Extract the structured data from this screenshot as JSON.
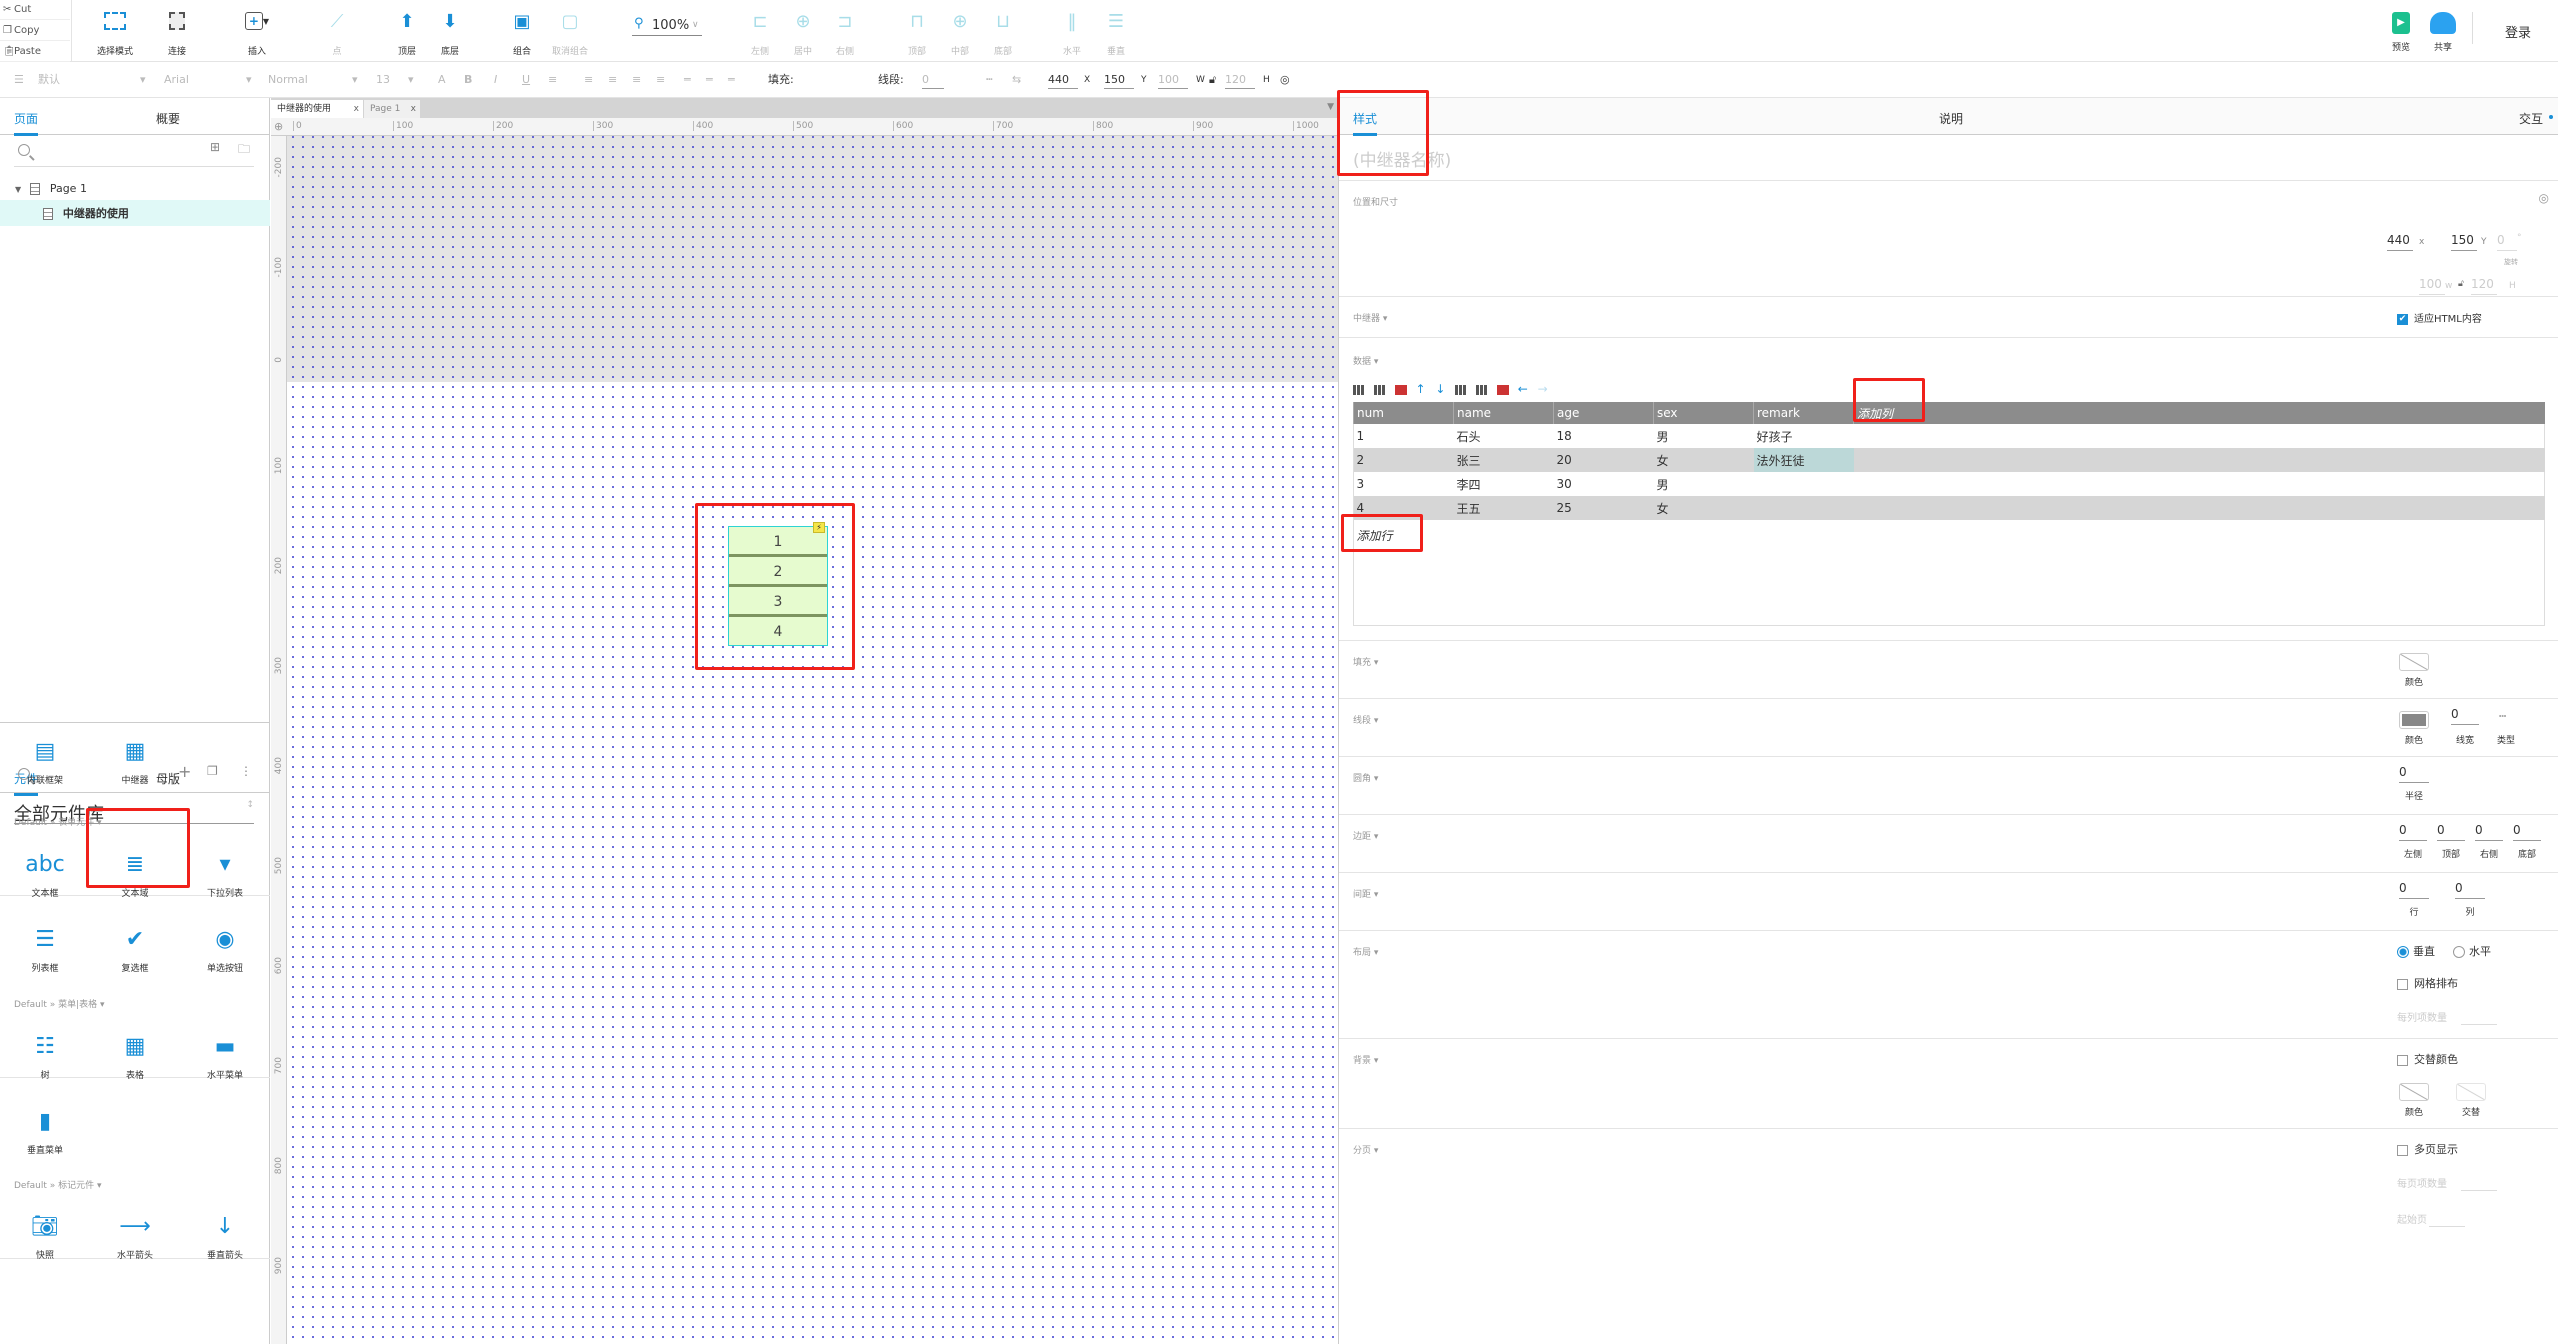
{
  "toolbar": {
    "clipboard": [
      {
        "label": "Cut",
        "icon": "scissors-icon"
      },
      {
        "label": "Copy",
        "icon": "copy-icon"
      },
      {
        "label": "Paste",
        "icon": "paste-icon"
      }
    ],
    "buttons": [
      {
        "label": "选择模式",
        "icon": "select-mode-icon",
        "enabled": true
      },
      {
        "label": "连接",
        "icon": "connect-icon",
        "enabled": true
      },
      {
        "label": "插入",
        "icon": "insert-icon",
        "enabled": true
      },
      {
        "label": "点",
        "icon": "point-icon",
        "enabled": false
      },
      {
        "label": "顶层",
        "icon": "bring-to-front-icon",
        "enabled": true
      },
      {
        "label": "底层",
        "icon": "send-to-back-icon",
        "enabled": true
      },
      {
        "label": "组合",
        "icon": "group-icon",
        "enabled": true
      },
      {
        "label": "取消组合",
        "icon": "ungroup-icon",
        "enabled": false
      },
      {
        "label": "左侧",
        "icon": "align-left-icon",
        "enabled": false
      },
      {
        "label": "居中",
        "icon": "align-center-icon",
        "enabled": false
      },
      {
        "label": "右侧",
        "icon": "align-right-icon",
        "enabled": false
      },
      {
        "label": "顶部",
        "icon": "align-top-icon",
        "enabled": false
      },
      {
        "label": "中部",
        "icon": "align-middle-icon",
        "enabled": false
      },
      {
        "label": "底部",
        "icon": "align-bottom-icon",
        "enabled": false
      },
      {
        "label": "水平",
        "icon": "distribute-horizontal-icon",
        "enabled": false
      },
      {
        "label": "垂直",
        "icon": "distribute-vertical-icon",
        "enabled": false
      }
    ],
    "zoom": "100%",
    "preview": "预览",
    "share": "共享",
    "login": "登录",
    "format": {
      "style": "默认",
      "font": "Arial",
      "weight": "Normal",
      "size": "13",
      "fill_label": "填充:",
      "stroke_label": "线段:",
      "stroke_value": "0",
      "x": "440",
      "x_unit": "X",
      "y": "150",
      "y_unit": "Y",
      "w": "100",
      "w_unit": "W",
      "h": "120",
      "h_unit": "H"
    }
  },
  "left": {
    "tabs": [
      "页面",
      "概要"
    ],
    "pages": [
      {
        "label": "Page 1",
        "level": 0
      },
      {
        "label": "中继器的使用",
        "level": 1,
        "selected": true
      }
    ],
    "widget_tabs": [
      "元件",
      "母版"
    ],
    "library": "全部元件库",
    "groups": [
      {
        "title": "",
        "items": [
          "内联框架",
          "中继器"
        ]
      },
      {
        "title": "Default » 表单元件 ▾",
        "items": [
          "文本框",
          "文本域",
          "下拉列表",
          "列表框",
          "复选框",
          "单选按钮"
        ]
      },
      {
        "title": "Default » 菜单|表格 ▾",
        "items": [
          "树",
          "表格",
          "水平菜单",
          "垂直菜单"
        ]
      },
      {
        "title": "Default » 标记元件 ▾",
        "items": [
          "快照",
          "水平箭头",
          "垂直箭头"
        ]
      }
    ]
  },
  "canvas": {
    "tabs": [
      {
        "label": "中继器的使用",
        "active": true
      },
      {
        "label": "Page 1",
        "active": false
      }
    ],
    "close": "x",
    "hruler": [
      "0",
      "100",
      "200",
      "300",
      "400",
      "500",
      "600",
      "700",
      "800",
      "900",
      "1000"
    ],
    "vruler": [
      "-200",
      "-100",
      "0",
      "100",
      "200",
      "300",
      "400",
      "500",
      "600",
      "700",
      "800",
      "900"
    ],
    "repeater_items": [
      "1",
      "2",
      "3",
      "4"
    ]
  },
  "right": {
    "tabs": [
      "样式",
      "说明",
      "交互"
    ],
    "name_placeholder": "(中继器名称)",
    "position": {
      "title": "位置和尺寸",
      "x": "440",
      "x_unit": "x",
      "y": "150",
      "y_unit": "Y",
      "rotation": "0",
      "rotation_unit": "°",
      "rotation_label": "旋转",
      "w": "100",
      "w_unit": "w",
      "h": "120",
      "h_unit": "H"
    },
    "repeater": {
      "title": "中继器 ▾",
      "fit_html": "适应HTML内容",
      "fit_html_checked": true
    },
    "data": {
      "title": "数据 ▾",
      "columns": [
        "num",
        "name",
        "age",
        "sex",
        "remark"
      ],
      "add_column": "添加列",
      "rows": [
        [
          "1",
          "石头",
          "18",
          "男",
          "好孩子"
        ],
        [
          "2",
          "张三",
          "20",
          "女",
          "法外狂徒"
        ],
        [
          "3",
          "李四",
          "30",
          "男",
          ""
        ],
        [
          "4",
          "王五",
          "25",
          "女",
          ""
        ]
      ],
      "add_row": "添加行"
    },
    "fill": {
      "title": "填充 ▾",
      "color_label": "颜色"
    },
    "stroke": {
      "title": "线段 ▾",
      "color_label": "颜色",
      "width": "0",
      "width_label": "线宽",
      "type_label": "类型"
    },
    "radius": {
      "title": "圆角 ▾",
      "value": "0",
      "label": "半径"
    },
    "padding": {
      "title": "边距 ▾",
      "values": [
        "0",
        "0",
        "0",
        "0"
      ],
      "labels": [
        "左侧",
        "顶部",
        "右侧",
        "底部"
      ]
    },
    "spacing": {
      "title": "间距 ▾",
      "values": [
        "0",
        "0"
      ],
      "labels": [
        "行",
        "列"
      ]
    },
    "layout": {
      "title": "布局 ▾",
      "vertical": "垂直",
      "horizontal": "水平",
      "selected": "垂直",
      "grid": "网格排布",
      "per_column": "每列项数量"
    },
    "background": {
      "title": "背景 ▾",
      "alternate": "交替颜色",
      "color_label": "颜色",
      "alt_label": "交替"
    },
    "paging": {
      "title": "分页 ▾",
      "multi": "多页显示",
      "per_page": "每页项数量",
      "start": "起始页"
    }
  },
  "colors": {
    "accent": "#1a8fd6",
    "annotation": "#f0201a",
    "repeater_fill": "#e6fbcf",
    "preview": "#1cc08f"
  }
}
